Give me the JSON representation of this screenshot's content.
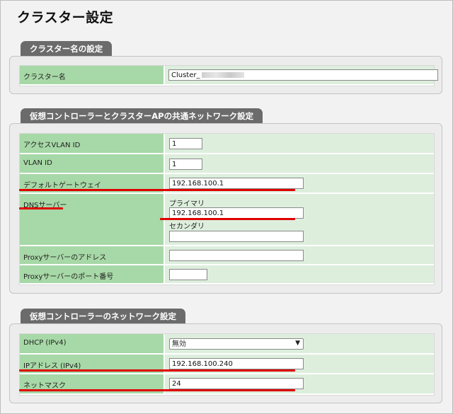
{
  "page": {
    "title": "クラスター設定"
  },
  "sections": {
    "cluster_name": {
      "tab": "クラスター名の設定",
      "label": "クラスター名",
      "value": "Cluster_"
    },
    "common_network": {
      "tab": "仮想コントローラーとクラスターAPの共通ネットワーク設定",
      "access_vlan_label": "アクセスVLAN ID",
      "access_vlan_value": "1",
      "vlan_label": "VLAN ID",
      "vlan_value": "1",
      "gateway_label": "デフォルトゲートウェイ",
      "gateway_value": "192.168.100.1",
      "dns_label": "DNSサーバー",
      "dns_primary_label": "プライマリ",
      "dns_primary_value": "192.168.100.1",
      "dns_secondary_label": "セカンダリ",
      "dns_secondary_value": "",
      "proxy_addr_label": "Proxyサーバーのアドレス",
      "proxy_addr_value": "",
      "proxy_port_label": "Proxyサーバーのポート番号",
      "proxy_port_value": ""
    },
    "vc_network": {
      "tab": "仮想コントローラーのネットワーク設定",
      "dhcp_label": "DHCP (IPv4)",
      "dhcp_value": "無効",
      "ip_label": "IPアドレス (IPv4)",
      "ip_value": "192.168.100.240",
      "netmask_label": "ネットマスク",
      "netmask_value": "24"
    }
  },
  "colors": {
    "label_bg": "#a7d8a7",
    "value_bg": "#ddeedd",
    "tab_bg": "#6b6b6b",
    "highlight": "#e00000"
  }
}
